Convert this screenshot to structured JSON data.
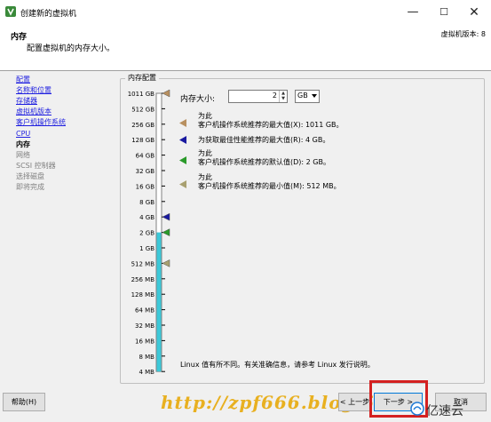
{
  "window": {
    "title": "创建新的虚拟机",
    "min_glyph": "—",
    "max_glyph": "☐",
    "close_glyph": "✕"
  },
  "header": {
    "title": "内存",
    "description": "配置虚拟机的内存大小。",
    "version": "虚拟机版本: 8"
  },
  "nav": {
    "items": [
      {
        "label": "配置",
        "state": "link"
      },
      {
        "label": "名称和位置",
        "state": "link"
      },
      {
        "label": "存储器",
        "state": "link"
      },
      {
        "label": "虚拟机版本",
        "state": "link"
      },
      {
        "label": "客户机操作系统",
        "state": "link"
      },
      {
        "label": "CPU",
        "state": "link"
      },
      {
        "label": "内存",
        "state": "current"
      },
      {
        "label": "网络",
        "state": "disabled"
      },
      {
        "label": "SCSI 控制器",
        "state": "disabled"
      },
      {
        "label": "选择磁盘",
        "state": "disabled"
      },
      {
        "label": "即将完成",
        "state": "disabled"
      }
    ]
  },
  "memory": {
    "group_label": "内存配置",
    "size_label": "内存大小:",
    "size_value": "2",
    "unit": "GB",
    "scale_ticks": [
      "1011 GB",
      "512 GB",
      "256 GB",
      "128 GB",
      "64 GB",
      "32 GB",
      "16 GB",
      "8 GB",
      "4 GB",
      "2 GB",
      "1 GB",
      "512 MB",
      "256 MB",
      "128 MB",
      "64 MB",
      "32 MB",
      "16 MB",
      "8 MB",
      "4 MB"
    ],
    "legend": [
      {
        "line1": "为此",
        "line2": "客户机操作系统推荐的最大值(X): 1011 GB。",
        "color": "#b89060"
      },
      {
        "line1": "",
        "line2": "为获取最佳性能推荐的最大值(R): 4 GB。",
        "color": "#1a1aa0"
      },
      {
        "line1": "为此",
        "line2": "客户机操作系统推荐的默认值(D): 2 GB。",
        "color": "#2a9a2a"
      },
      {
        "line1": "为此",
        "line2": "客户机操作系统推荐的最小值(M): 512 MB。",
        "color": "#a8a070"
      }
    ],
    "note": "Linux 值有所不同。有关准确信息，请参考 Linux 发行说明。",
    "fill_color": "#3cc8d8"
  },
  "footer": {
    "help_label": "帮助(H)",
    "back_label": "< 上一步",
    "next_label": "下一步 >",
    "cancel_label": "取消"
  },
  "watermark": {
    "text": "http://zpf666.blog.51",
    "brand": "亿速云"
  }
}
